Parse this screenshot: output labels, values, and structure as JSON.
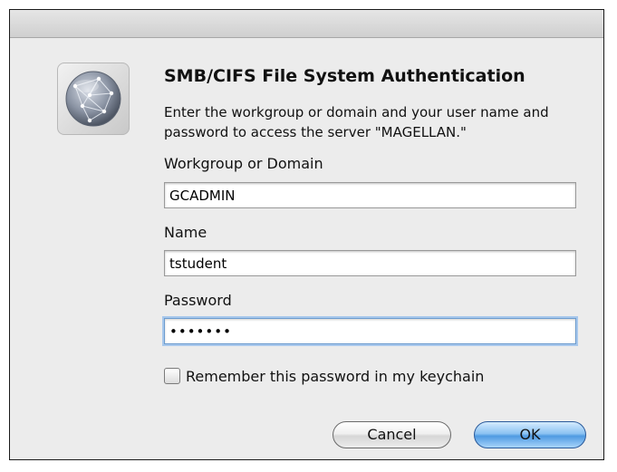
{
  "dialog": {
    "title": "SMB/CIFS File System Authentication",
    "description": "Enter the workgroup or domain and your user name and password to access the server \"MAGELLAN.\"",
    "icon": "network-globe-icon"
  },
  "fields": {
    "workgroup": {
      "label": "Workgroup or Domain",
      "value": "GCADMIN"
    },
    "name": {
      "label": "Name",
      "value": "tstudent"
    },
    "password": {
      "label": "Password",
      "value": "•••••••"
    }
  },
  "remember": {
    "label": "Remember this password in my keychain",
    "checked": false
  },
  "buttons": {
    "cancel": "Cancel",
    "ok": "OK"
  },
  "colors": {
    "default_button": "#5ba2e6",
    "focus_ring": "#a8c8ec"
  }
}
